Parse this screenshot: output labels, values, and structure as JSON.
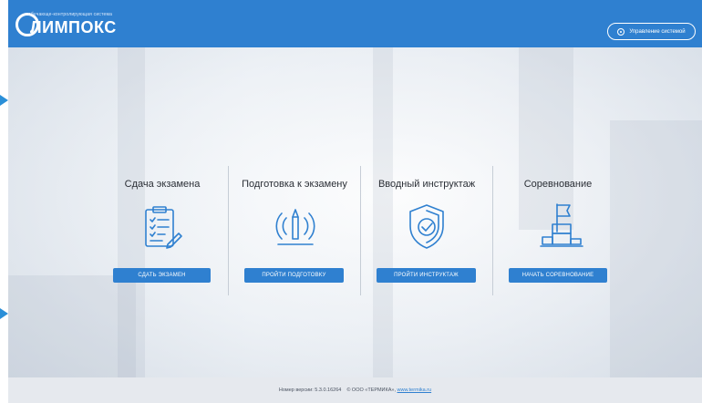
{
  "header": {
    "logo_tagline": "обучающе-контролирующая система",
    "logo_text": "ЛИМПОКС",
    "manage_label": "Управление системой"
  },
  "sections": [
    {
      "title": "Сдача экзамена",
      "button": "СДАТЬ ЭКЗАМЕН",
      "icon": "exam-checklist-icon"
    },
    {
      "title": "Подготовка к экзамену",
      "button": "ПРОЙТИ ПОДГОТОВКУ",
      "icon": "pencil-target-icon"
    },
    {
      "title": "Вводный инструктаж",
      "button": "ПРОЙТИ ИНСТРУКТАЖ",
      "icon": "shield-check-icon"
    },
    {
      "title": "Соревнование",
      "button": "НАЧАТЬ СОРЕВНОВАНИЕ",
      "icon": "podium-flag-icon"
    }
  ],
  "footer": {
    "version": "Номер версии: 5.3.0.16264",
    "copyright": "© ООО «ТЕРМИКА»,",
    "link": "www.termika.ru"
  },
  "colors": {
    "accent": "#2f80d0",
    "icon": "#2f80d0",
    "side_arrow": "#2a8fd8"
  }
}
